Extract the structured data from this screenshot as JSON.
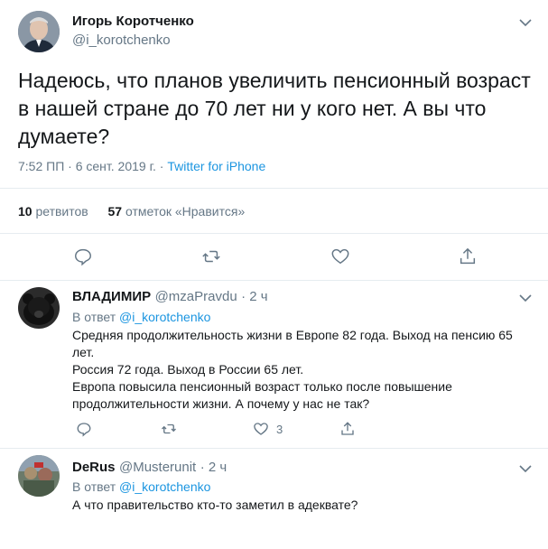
{
  "main_tweet": {
    "author_name": "Игорь Коротченко",
    "author_handle": "@i_korotchenko",
    "text": "Надеюсь, что планов увеличить пенсионный возраст в нашей стране до 70 лет ни у кого нет. А вы что думаете?",
    "timestamp": "7:52 ПП · 6 сент. 2019 г. · ",
    "source": "Twitter for iPhone",
    "retweets_count": "10",
    "retweets_label": "ретвитов",
    "likes_count": "57",
    "likes_label": "отметок «Нравится»"
  },
  "replies": [
    {
      "author_name": "ВЛАДИМИР",
      "author_handle": "@mzaPravdu",
      "time": "· 2 ч",
      "in_reply_prefix": "В ответ ",
      "in_reply_handle": "@i_korotchenko",
      "text_lines": [
        "Средняя продолжительность жизни в Европе 82 года. Выход на пенсию 65 лет.",
        "Россия 72 года. Выход в России 65 лет.",
        "Европа повысила пенсионный возраст только после повышение продолжительности жизни. А почему у нас не так?"
      ],
      "like_count": "3"
    },
    {
      "author_name": "DeRus",
      "author_handle": "@Musterunit",
      "time": "· 2 ч",
      "in_reply_prefix": "В ответ ",
      "in_reply_handle": "@i_korotchenko",
      "text_lines": [
        "А что правительство кто-то заметил в адеквате?"
      ]
    }
  ],
  "icons": {
    "chevron": "chevron-down-icon",
    "reply": "reply-icon",
    "retweet": "retweet-icon",
    "like": "heart-icon",
    "share": "share-icon"
  }
}
